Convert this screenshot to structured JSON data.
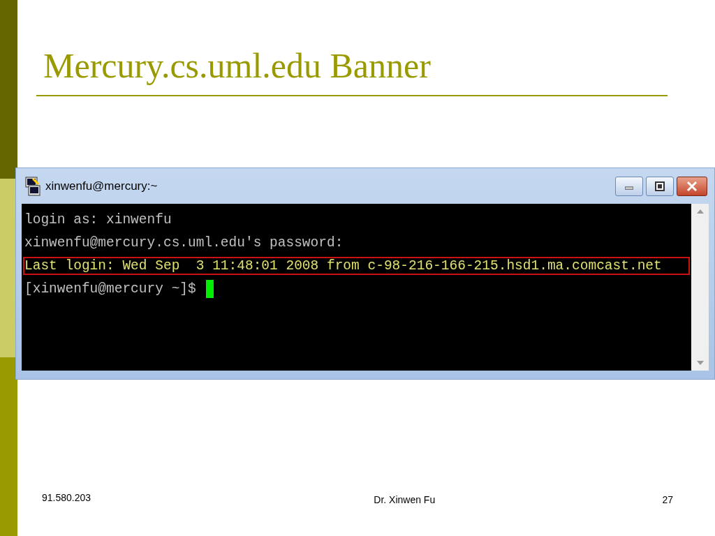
{
  "slide": {
    "title": "Mercury.cs.uml.edu Banner"
  },
  "terminal": {
    "title": "xinwenfu@mercury:~",
    "lines": [
      {
        "kind": "output",
        "text": "login as: xinwenfu",
        "highlighted": false
      },
      {
        "kind": "output",
        "text": "xinwenfu@mercury.cs.uml.edu's password:",
        "highlighted": false
      },
      {
        "kind": "output",
        "text": "Last login: Wed Sep  3 11:48:01 2008 from c-98-216-166-215.hsd1.ma.comcast.net",
        "highlighted": true
      },
      {
        "kind": "prompt",
        "text": "[xinwenfu@mercury ~]$",
        "highlighted": false
      }
    ]
  },
  "footer": {
    "course": "91.580.203",
    "author": "Dr. Xinwen Fu",
    "page": "27"
  }
}
